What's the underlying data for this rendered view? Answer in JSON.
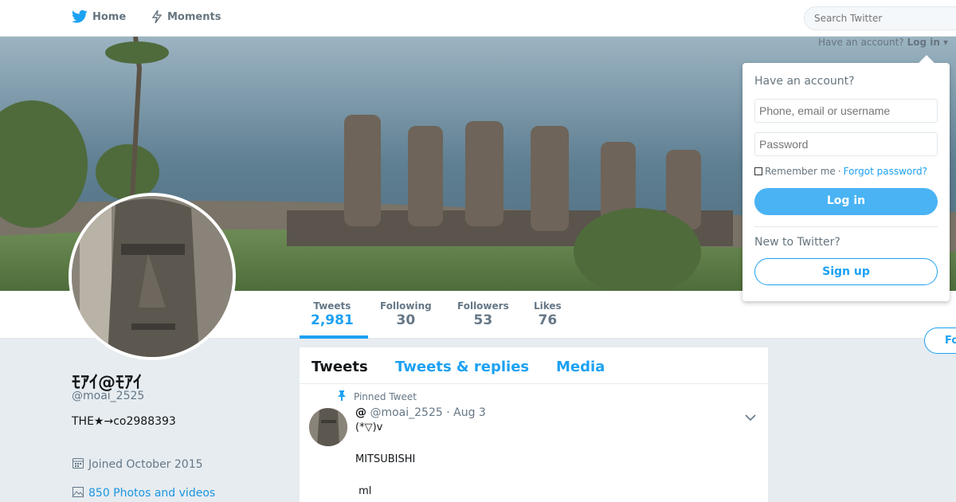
{
  "nav": {
    "home_label": "Home",
    "moments_label": "Moments",
    "search_placeholder": "Search Twitter",
    "have_account_text": "Have an account?",
    "login_link": "Log in"
  },
  "colors": {
    "accent": "#1da1f2",
    "login_button": "#4ab3f4",
    "background": "#e6ecf0"
  },
  "profile": {
    "name": "ﾓｱｲ@ﾓｱｲ",
    "handle": "@moai_2525",
    "bio": "THE★→co2988393",
    "joined": "Joined October 2015",
    "photos_link": "850 Photos and videos",
    "follow_label": "Follow"
  },
  "stats": [
    {
      "label": "Tweets",
      "value": "2,981",
      "active": true
    },
    {
      "label": "Following",
      "value": "30"
    },
    {
      "label": "Followers",
      "value": "53"
    },
    {
      "label": "Likes",
      "value": "76"
    }
  ],
  "timeline": {
    "tabs": [
      "Tweets",
      "Tweets & replies",
      "Media"
    ],
    "pinned_label": "Pinned Tweet",
    "tweet": {
      "name": "@",
      "handle": "@moai_2525",
      "date": "Aug 3",
      "lines": [
        "(*▽)v",
        "MITSUBISHI",
        " ml"
      ]
    }
  },
  "login": {
    "title": "Have an account?",
    "username_placeholder": "Phone, email or username",
    "password_placeholder": "Password",
    "remember_label": "Remember me",
    "separator": "·",
    "forgot_label": "Forgot password?",
    "login_button": "Log in",
    "new_label": "New to Twitter?",
    "signup_button": "Sign up"
  }
}
